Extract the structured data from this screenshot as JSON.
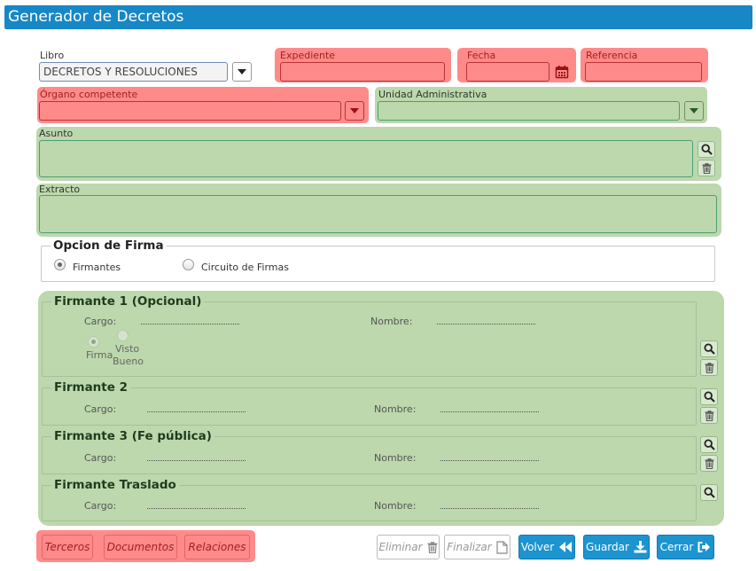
{
  "window": {
    "title": "Generador de Decretos"
  },
  "form": {
    "libro": {
      "label": "Libro",
      "value": "DECRETOS Y RESOLUCIONES"
    },
    "expediente": {
      "label": "Expediente",
      "value": ""
    },
    "fecha": {
      "label": "Fecha",
      "value": ""
    },
    "referencia": {
      "label": "Referencia",
      "value": ""
    },
    "organo": {
      "label": "Órgano competente",
      "value": ""
    },
    "unidad": {
      "label": "Unidad Administrativa",
      "value": ""
    },
    "asunto": {
      "label": "Asunto",
      "value": ""
    },
    "extracto": {
      "label": "Extracto",
      "value": ""
    }
  },
  "opcion_firma": {
    "legend": "Opcion de Firma",
    "options": [
      "Firmantes",
      "Circuito de Firmas"
    ],
    "selected": "Firmantes"
  },
  "firmantes": [
    {
      "legend": "Firmante 1 (Opcional)",
      "cargo_label": "Cargo:",
      "nombre_label": "Nombre:",
      "radio_firma": "Firma",
      "radio_visto_1": "Visto",
      "radio_visto_2": "Bueno"
    },
    {
      "legend": "Firmante 2",
      "cargo_label": "Cargo:",
      "nombre_label": "Nombre:"
    },
    {
      "legend": "Firmante 3 (Fe pública)",
      "cargo_label": "Cargo:",
      "nombre_label": "Nombre:"
    },
    {
      "legend": "Firmante Traslado",
      "cargo_label": "Cargo:",
      "nombre_label": "Nombre:"
    }
  ],
  "bottom": {
    "terceros": "Terceros",
    "documentos": "Documentos",
    "relaciones": "Relaciones",
    "eliminar": "Eliminar",
    "finalizar": "Finalizar",
    "volver": "Volver",
    "guardar": "Guardar",
    "cerrar": "Cerrar"
  },
  "colors": {
    "header": "#1787c6",
    "required": "#ff8a8a",
    "optional": "#bcd8ac",
    "primary_button": "#1c94d0"
  }
}
